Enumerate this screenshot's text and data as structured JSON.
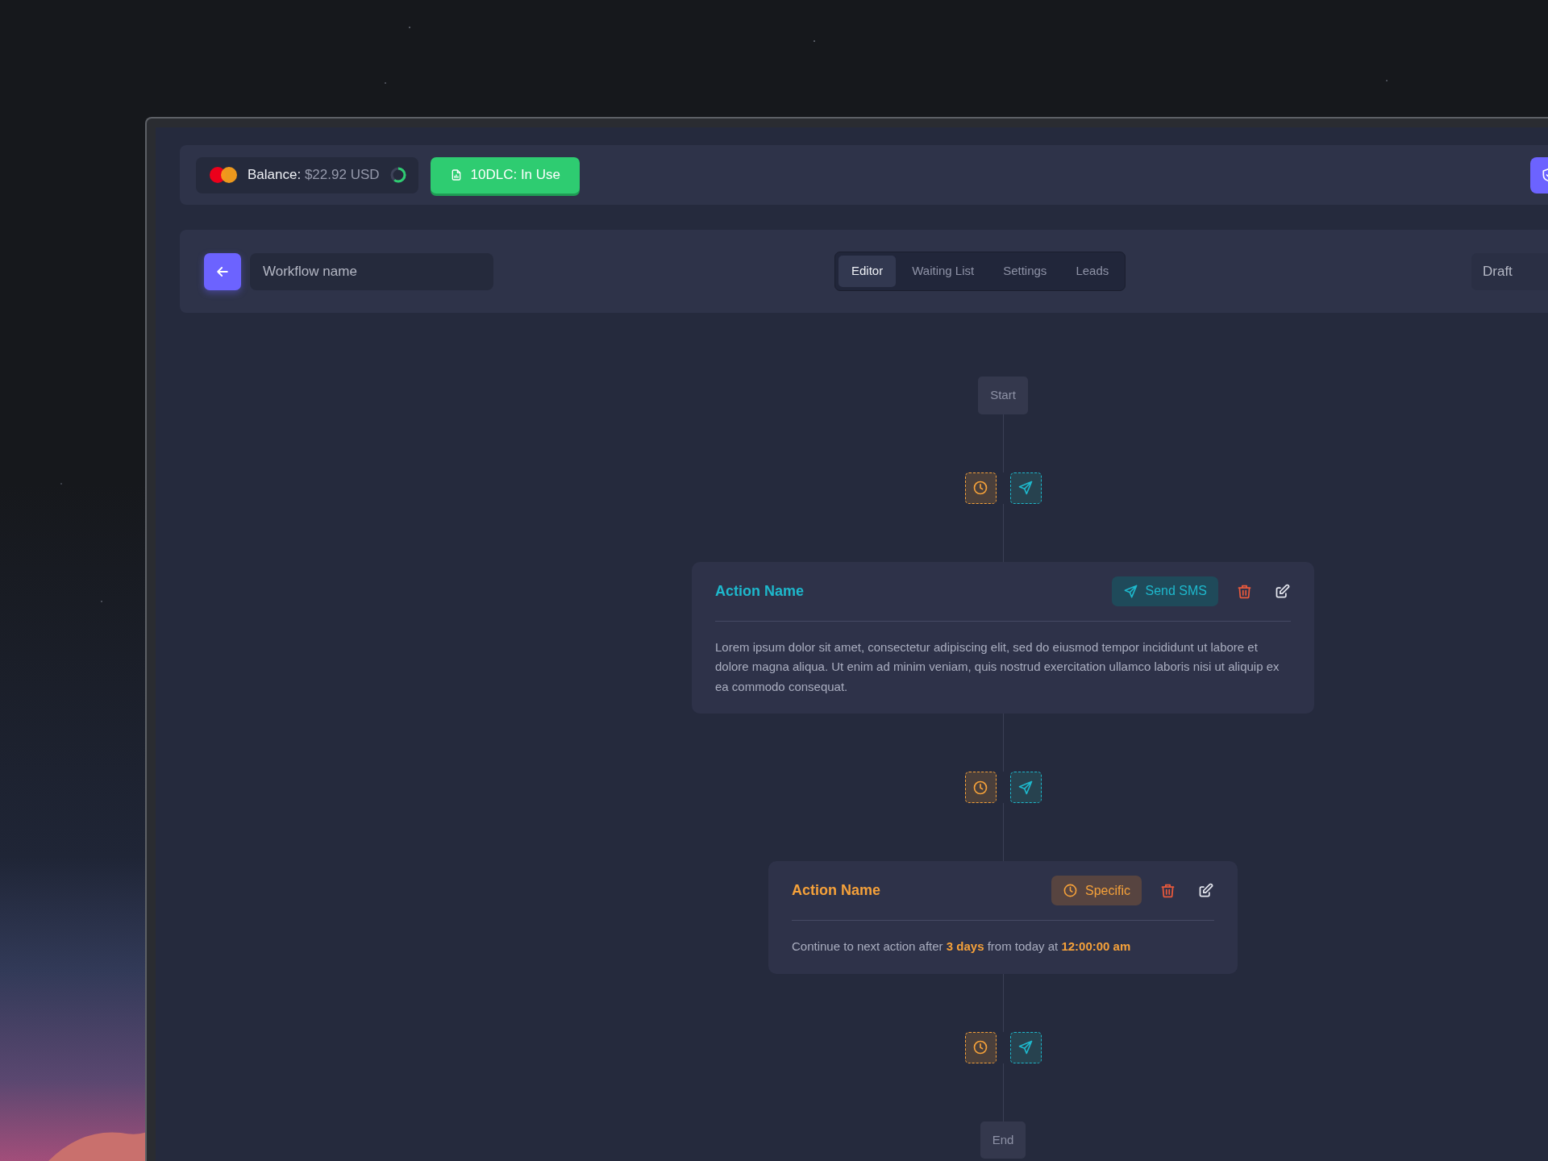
{
  "top_bar": {
    "balance_label": "Balance:",
    "balance_value": "$22.92 USD",
    "balance_ring": {
      "level": 0.6
    },
    "status_button": "10DLC: In Use"
  },
  "header": {
    "workflow_name_placeholder": "Workflow name",
    "tabs": [
      {
        "label": "Editor",
        "selected": true
      },
      {
        "label": "Waiting List",
        "selected": false
      },
      {
        "label": "Settings",
        "selected": false
      },
      {
        "label": "Leads",
        "selected": false
      }
    ],
    "status": "Draft"
  },
  "flow": {
    "start": "Start",
    "end": "End",
    "actions": [
      {
        "kind": "sms",
        "title": "Action Name",
        "badge": "Send SMS",
        "description": "Lorem ipsum dolor sit amet, consectetur adipiscing elit, sed do eiusmod tempor incididunt ut labore et dolore magna aliqua. Ut enim ad minim veniam, quis nostrud exercitation ullamco laboris nisi ut aliquip ex ea commodo consequat."
      },
      {
        "kind": "delay",
        "title": "Action Name",
        "badge": "Specific",
        "description": "Continue to next action after **3 days** from today at **12:00:00 am**"
      }
    ]
  }
}
